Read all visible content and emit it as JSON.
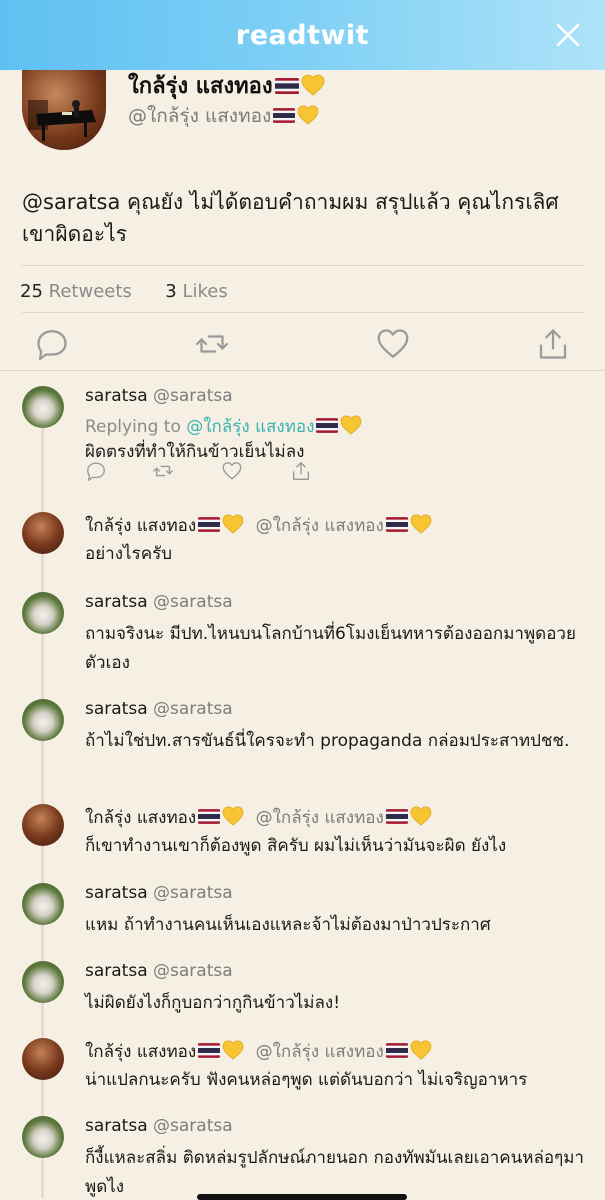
{
  "app": {
    "title": "readtwit"
  },
  "main_tweet": {
    "name": "ใกล้รุ่ง แสงทอง",
    "handle": "@ใกล้รุ่ง แสงทอง",
    "text": "@saratsa คุณยัง ไม่ได้ตอบคำถามผม สรุปแล้ว คุณไกรเลิศเขาผิดอะไร",
    "retweets_count": "25",
    "retweets_label": "Retweets",
    "likes_count": "3",
    "likes_label": "Likes"
  },
  "replies": [
    {
      "name": "saratsa",
      "handle": "@saratsa",
      "replying_label": "Replying to",
      "replying_to": "@ใกล้รุ่ง แสงทอง",
      "text": "ผิดตรงที่ทำให้กินข้าวเย็นไม่ลง"
    },
    {
      "name": "ใกล้รุ่ง แสงทอง",
      "handle": "@ใกล้รุ่ง แสงทอง",
      "text": "อย่างไรครับ"
    },
    {
      "name": "saratsa",
      "handle": "@saratsa",
      "text": "ถามจริงนะ มีปท.ไหนบนโลกบ้านที่6โมงเย็นทหารต้องออกมาพูดอวยตัวเอง"
    },
    {
      "name": "saratsa",
      "handle": "@saratsa",
      "text": "ถ้าไม่ใช่ปท.สารขันธ์นี่ใครจะทำ propaganda กล่อมประสาทปชช."
    },
    {
      "name": "ใกล้รุ่ง แสงทอง",
      "handle": "@ใกล้รุ่ง แสงทอง",
      "text": "ก็เขาทำงานเขาก็ต้องพูด สิครับ ผมไม่เห็นว่ามันจะผิด ยังไง"
    },
    {
      "name": "saratsa",
      "handle": "@saratsa",
      "text": "แหม ถ้าทำงานคนเห็นเองแหละจ้าไม่ต้องมาป่าวประกาศ"
    },
    {
      "name": "saratsa",
      "handle": "@saratsa",
      "text": "ไม่ผิดยังไงก็กูบอกว่ากูกินข้าวไม่ลง!"
    },
    {
      "name": "ใกล้รุ่ง แสงทอง",
      "handle": "@ใกล้รุ่ง แสงทอง",
      "text": "น่าแปลกนะครับ ฟังคนหล่อๆพูด แต่ดันบอกว่า ไม่เจริญอาหาร"
    },
    {
      "name": "saratsa",
      "handle": "@saratsa",
      "text": "ก็งี้แหละสลิ่ม ติดหล่มรูปลักษณ์ภายนอก กองทัพมันเลยเอาคนหล่อๆมาพูดไง"
    }
  ],
  "colors": {
    "header_start": "#5ec0f2",
    "header_end": "#aee3f8",
    "background": "#f6efe3",
    "mention": "#3ab3b0",
    "muted_text": "#7d7d7d",
    "icon_gray": "#9a9a9a"
  },
  "icons": {
    "close": "close-icon",
    "reply": "reply-icon",
    "retweet": "retweet-icon",
    "like": "heart-icon",
    "share": "share-icon",
    "flag": "thailand-flag-icon",
    "yellow_heart": "yellow-heart-icon"
  }
}
